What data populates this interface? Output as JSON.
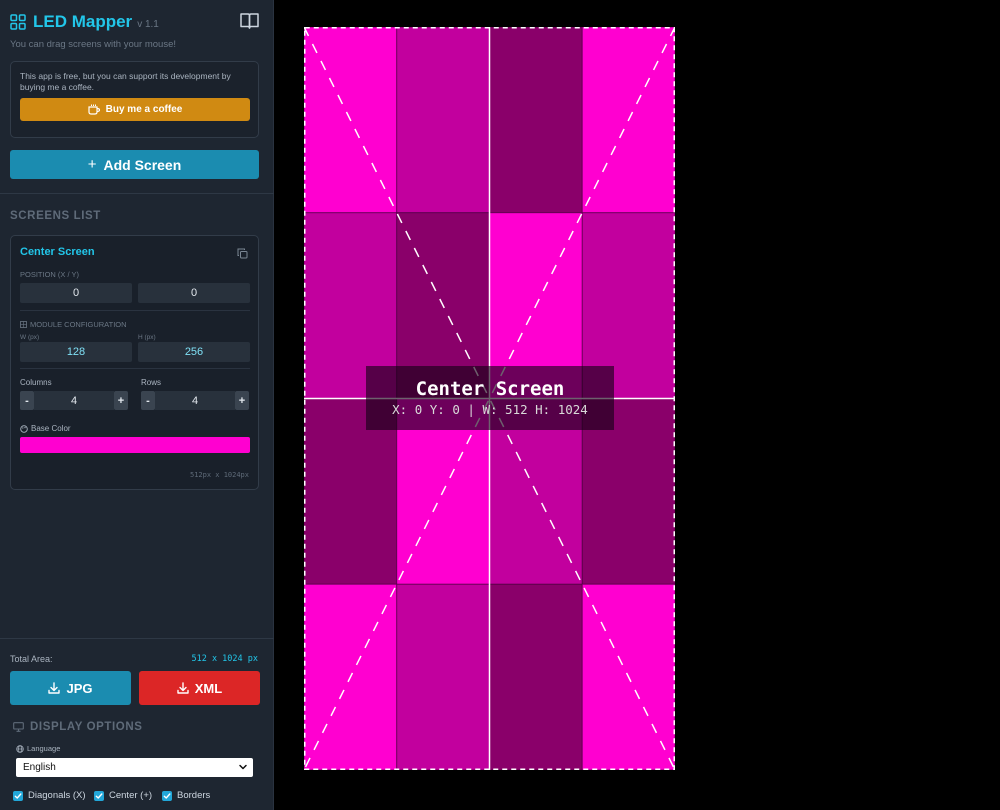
{
  "app": {
    "title": "LED Mapper",
    "version": "v 1.1",
    "hint": "You can drag screens with your mouse!"
  },
  "support": {
    "text": "This app is free, but you can support its development by buying me a coffee.",
    "button_label": "Buy me a coffee"
  },
  "add_screen": {
    "label": "Add Screen"
  },
  "screens_list": {
    "title": "SCREENS LIST",
    "items": [
      {
        "name": "Center Screen",
        "position_label": "POSITION (X / Y)",
        "x": "0",
        "y": "0",
        "module_label": "MODULE CONFIGURATION",
        "w_label": "W (px)",
        "h_label": "H (px)",
        "w": "128",
        "h": "256",
        "columns_label": "Columns",
        "rows_label": "Rows",
        "columns": "4",
        "rows": "4",
        "minus": "-",
        "plus": "+",
        "base_color_label": "Base Color",
        "base_color": "#ff00d0",
        "dims": "512px x 1024px"
      }
    ]
  },
  "total": {
    "label": "Total Area:",
    "value": "512 x 1024 px"
  },
  "export": {
    "jpg_label": "JPG",
    "xml_label": "XML",
    "jpg_color": "#1b8cb0",
    "xml_color": "#dc2626"
  },
  "display_options": {
    "title": "DISPLAY OPTIONS",
    "language_label": "Language",
    "language_value": "English",
    "diagonals_label": "Diagonals (X)",
    "center_label": "Center (+)",
    "borders_label": "Borders"
  },
  "canvas": {
    "screen_name": "Center Screen",
    "info": "X: 0 Y: 0 | W: 512 H: 1024",
    "columns": 4,
    "rows": 4,
    "shades": [
      "#ff00d0",
      "#c2009e",
      "#8a006a"
    ],
    "grid_pattern": [
      [
        0,
        1,
        2,
        0
      ],
      [
        1,
        2,
        0,
        1
      ],
      [
        2,
        0,
        1,
        2
      ],
      [
        0,
        1,
        2,
        0
      ]
    ]
  },
  "icons": [
    "grid-logo-icon",
    "book-icon",
    "coffee-icon",
    "copy-icon",
    "module-icon",
    "palette-icon",
    "download-icon",
    "monitor-icon",
    "globe-icon",
    "chevron-down-icon",
    "check-icon"
  ]
}
